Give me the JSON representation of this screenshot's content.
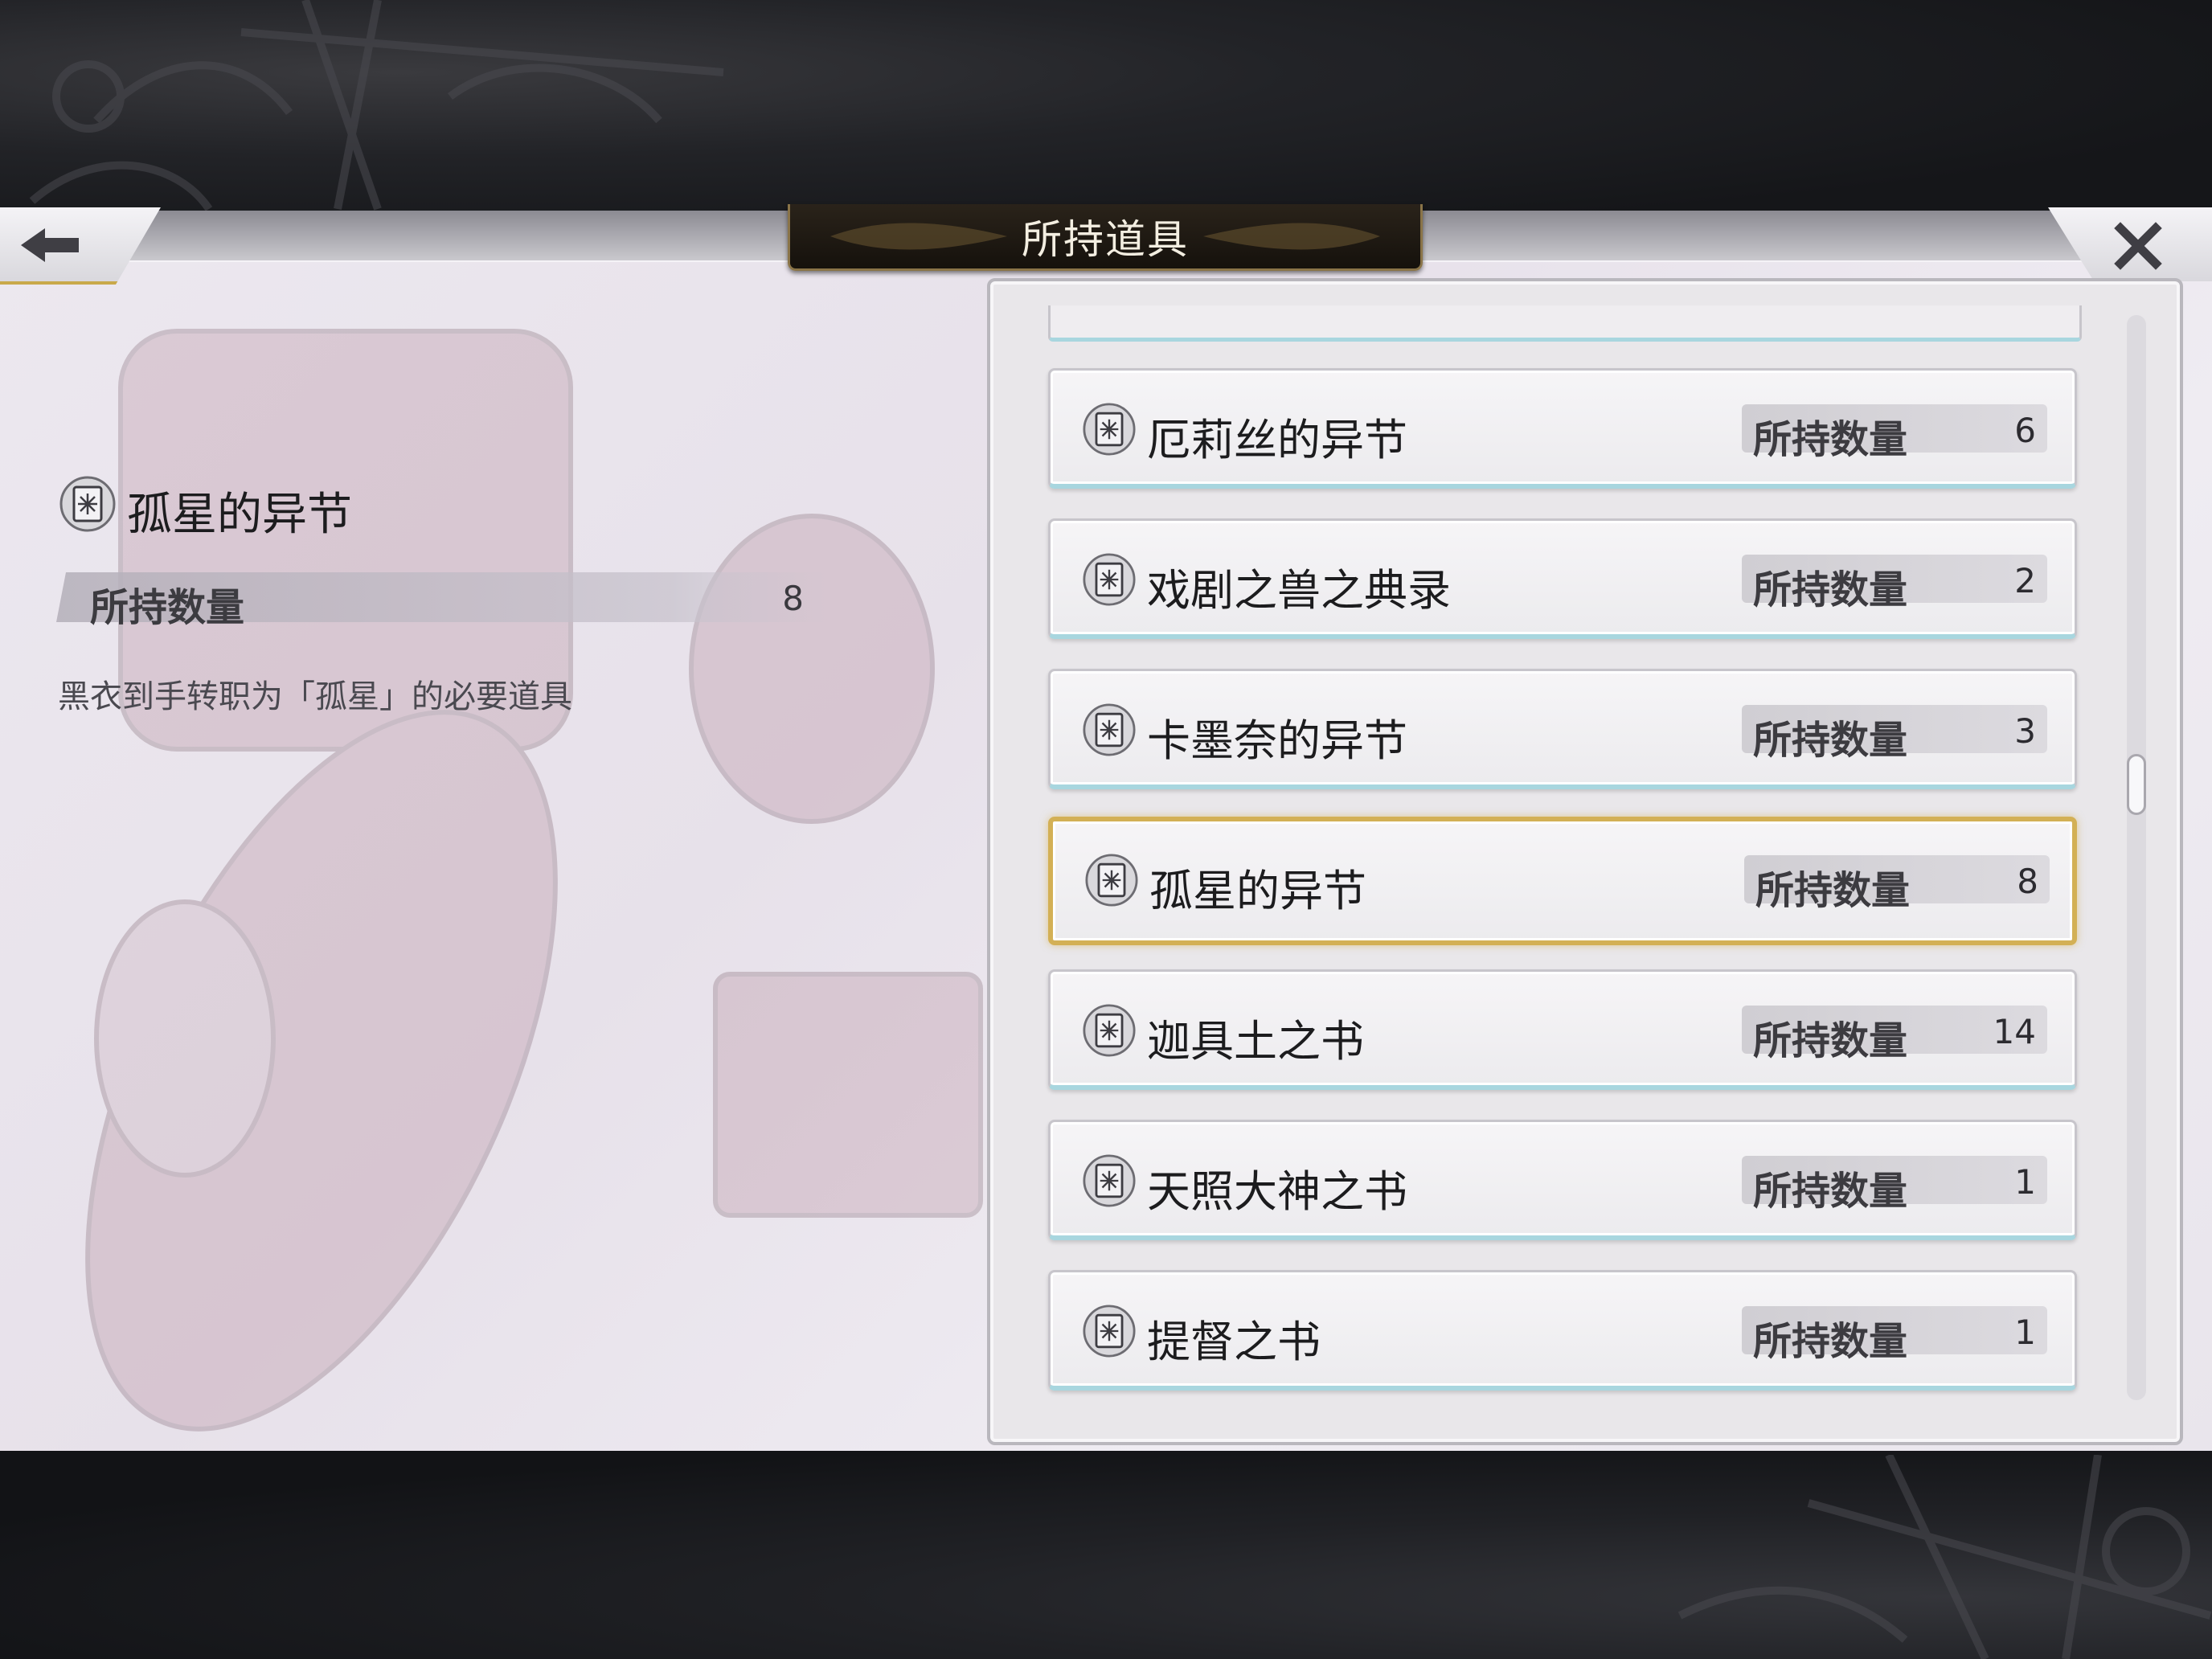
{
  "header": {
    "title": "所持道具",
    "back_icon": "arrow-left-icon",
    "close_icon": "close-x-icon"
  },
  "detail": {
    "name": "孤星的异节",
    "qty_label": "所持数量",
    "qty_value": "8",
    "description": "黑衣到手转职为「孤星」的必要道具",
    "icon": "book-icon"
  },
  "items": [
    {
      "name": "厄莉丝的异节",
      "qty_label": "所持数量",
      "qty": "6"
    },
    {
      "name": "戏剧之兽之典录",
      "qty_label": "所持数量",
      "qty": "2"
    },
    {
      "name": "卡墨奈的异节",
      "qty_label": "所持数量",
      "qty": "3"
    },
    {
      "name": "孤星的异节",
      "qty_label": "所持数量",
      "qty": "8",
      "selected": true
    },
    {
      "name": "迦具土之书",
      "qty_label": "所持数量",
      "qty": "14"
    },
    {
      "name": "天照大神之书",
      "qty_label": "所持数量",
      "qty": "1"
    },
    {
      "name": "提督之书",
      "qty_label": "所持数量",
      "qty": "1"
    }
  ],
  "colors": {
    "selected_border": "#d3b055",
    "card_bottom_accent": "#a8d6df",
    "title_plate": "#15110c"
  }
}
